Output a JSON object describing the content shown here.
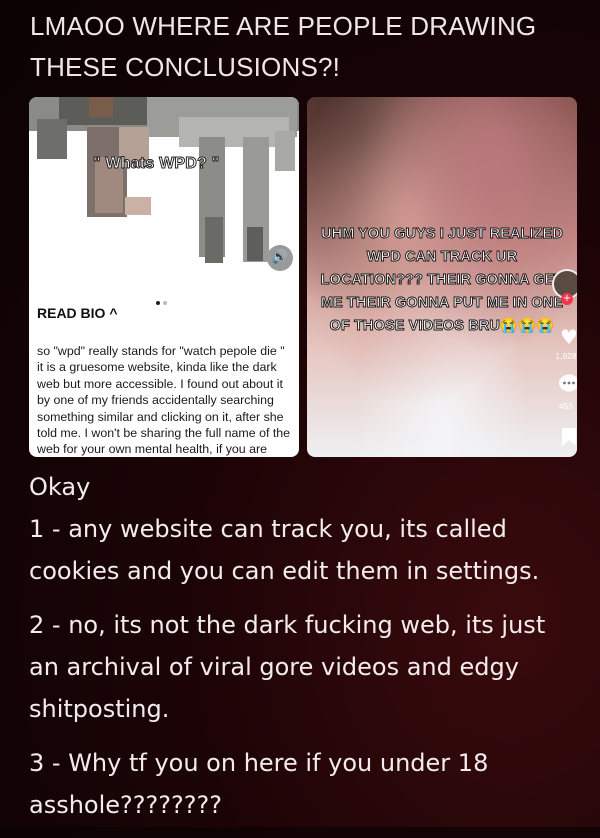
{
  "post": {
    "title": "LMAOO WHERE ARE PEOPLE DRAWING THESE CONCLUSIONS?!"
  },
  "left_card": {
    "caption": "\" Whats WPD? \"",
    "read_bio": "READ BIO ^",
    "bio_text": "so \"wpd\" really stands for \"watch pepole die \" it is a gruesome website, kinda like the dark web but more accessible. I found out about it by one of my friends accidentally searching something similar and clicking on it, after she told me. I won't be sharing the full name of the web for your own mental health, if you are THAT curious I could say",
    "sound_icon": "speaker-icon"
  },
  "right_card": {
    "caption": "UHM YOU GUYS I JUST REALIZED WPD CAN TRACK UR LOCATION??? THEIR GONNA GET ME THEIR GONNA PUT ME IN ONE OF THOSE VIDEOS BRU😭😭😭",
    "like_count": "1,928",
    "comment_count": "455",
    "icons": [
      "heart-icon",
      "comment-icon",
      "bookmark-icon"
    ]
  },
  "comment": {
    "line0": "Okay",
    "point1": "1 - any website can track you, its called cookies and you can edit them in settings.",
    "point2": "2 - no, its not the dark fucking web, its just an archival of viral gore videos and edgy shitposting.",
    "point3": "3 - Why tf you on here if you under 18 asshole????????"
  },
  "colors": {
    "background": "#1c0406",
    "text": "#f2eaea",
    "follow_red": "#f0364f"
  }
}
